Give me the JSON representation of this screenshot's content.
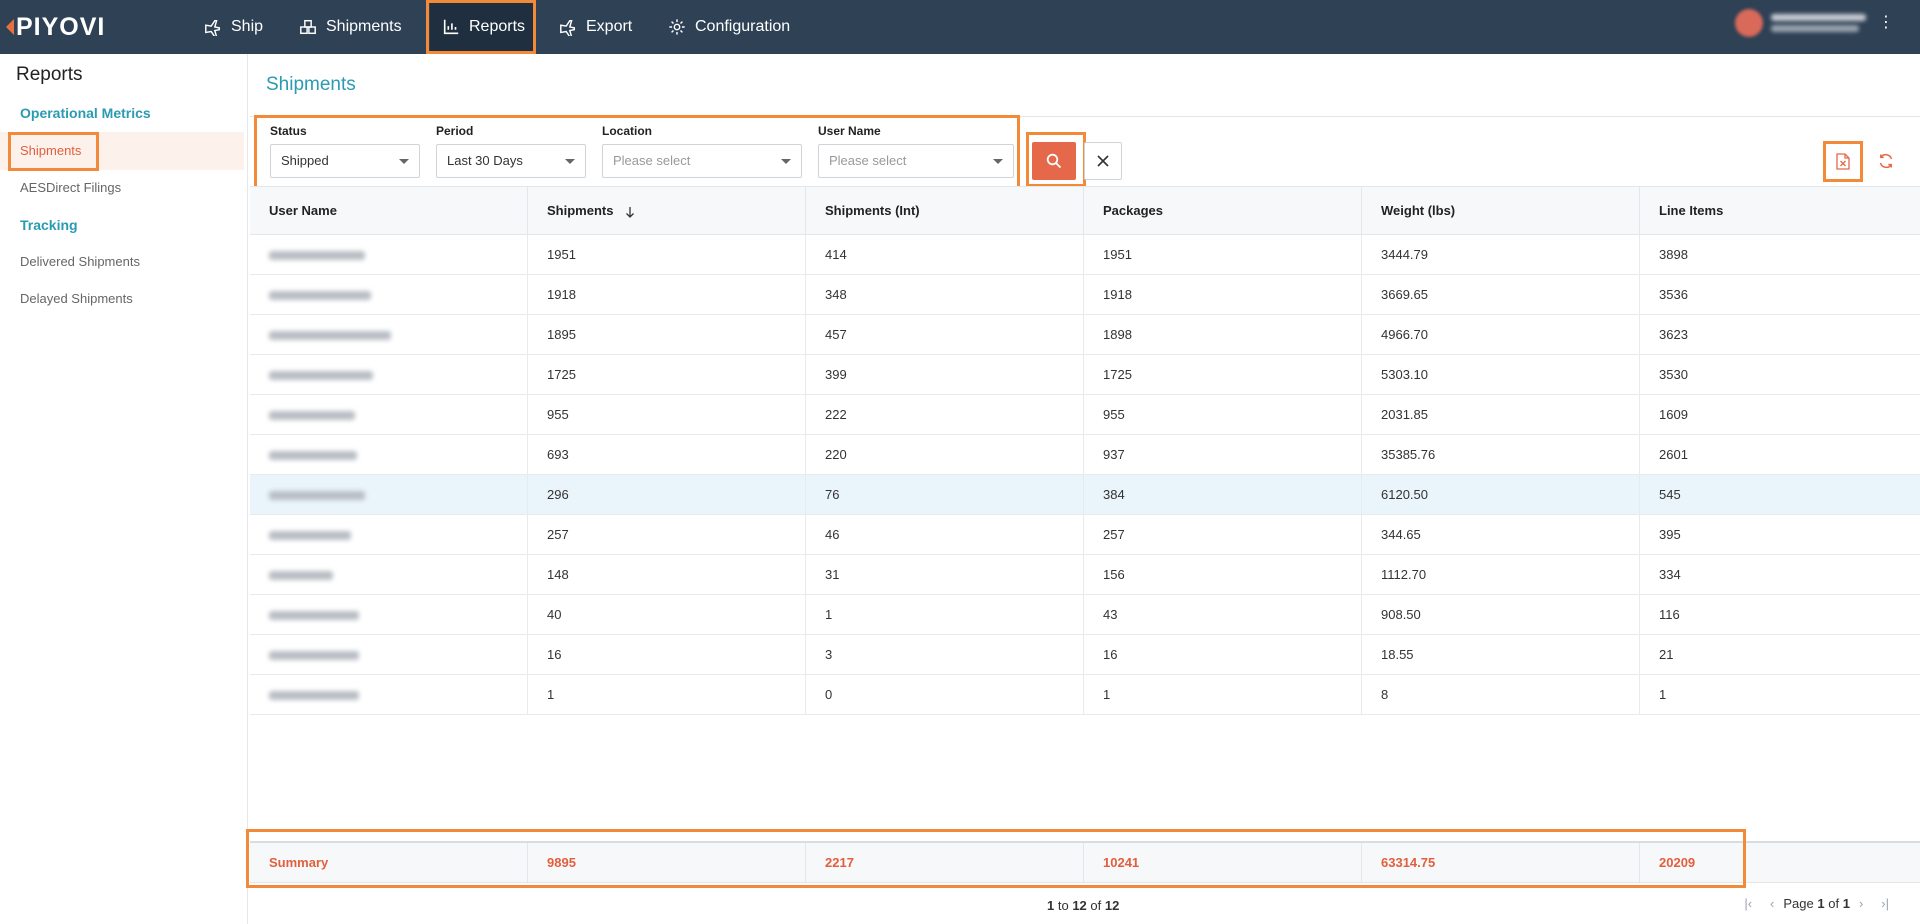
{
  "brand": {
    "name": "PIYOVI"
  },
  "nav": {
    "items": [
      {
        "label": "Ship",
        "icon": "plane-icon"
      },
      {
        "label": "Shipments",
        "icon": "boxes-icon"
      },
      {
        "label": "Reports",
        "icon": "chart-icon"
      },
      {
        "label": "Export",
        "icon": "export-plane-icon"
      },
      {
        "label": "Configuration",
        "icon": "gear-icon"
      }
    ],
    "active": "Reports"
  },
  "sidebar": {
    "title": "Reports",
    "sections": [
      {
        "heading": "Operational Metrics",
        "items": [
          "Shipments",
          "AESDirect Filings"
        ]
      },
      {
        "heading": "Tracking",
        "items": [
          "Delivered Shipments",
          "Delayed Shipments"
        ]
      }
    ],
    "active_item": "Shipments"
  },
  "page": {
    "title": "Shipments"
  },
  "filters": {
    "status": {
      "label": "Status",
      "value": "Shipped"
    },
    "period": {
      "label": "Period",
      "value": "Last 30 Days"
    },
    "location": {
      "label": "Location",
      "placeholder": "Please select"
    },
    "user_name": {
      "label": "User Name",
      "placeholder": "Please select"
    }
  },
  "table": {
    "columns": [
      "User Name",
      "Shipments",
      "Shipments (Int)",
      "Packages",
      "Weight (lbs)",
      "Line Items"
    ],
    "sorted_column": "Shipments",
    "sort_direction": "desc",
    "rows": [
      [
        "",
        "1951",
        "414",
        "1951",
        "3444.79",
        "3898"
      ],
      [
        "",
        "1918",
        "348",
        "1918",
        "3669.65",
        "3536"
      ],
      [
        "",
        "1895",
        "457",
        "1898",
        "4966.70",
        "3623"
      ],
      [
        "",
        "1725",
        "399",
        "1725",
        "5303.10",
        "3530"
      ],
      [
        "",
        "955",
        "222",
        "955",
        "2031.85",
        "1609"
      ],
      [
        "",
        "693",
        "220",
        "937",
        "35385.76",
        "2601"
      ],
      [
        "",
        "296",
        "76",
        "384",
        "6120.50",
        "545"
      ],
      [
        "",
        "257",
        "46",
        "257",
        "344.65",
        "395"
      ],
      [
        "",
        "148",
        "31",
        "156",
        "1112.70",
        "334"
      ],
      [
        "",
        "40",
        "1",
        "43",
        "908.50",
        "116"
      ],
      [
        "",
        "16",
        "3",
        "16",
        "18.55",
        "21"
      ],
      [
        "",
        "1",
        "0",
        "1",
        "8",
        "1"
      ]
    ],
    "selected_row": 6
  },
  "summary": {
    "label": "Summary",
    "values": [
      "9895",
      "2217",
      "10241",
      "63314.75",
      "20209"
    ]
  },
  "pagination": {
    "from": "1",
    "to_word": "to",
    "to": "12",
    "of_word": "of",
    "total": "12",
    "page_word": "Page",
    "page": "1",
    "pages": "1"
  },
  "colors": {
    "topbar": "#2e4155",
    "accent": "#e6684b",
    "teal": "#2a9bb0",
    "highlight": "#f28a3a"
  }
}
